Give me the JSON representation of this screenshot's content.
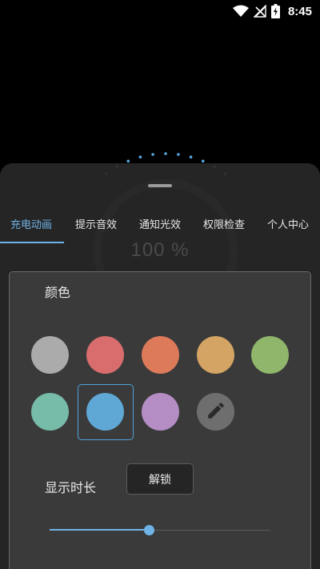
{
  "status_bar": {
    "time": "8:45",
    "icons": [
      "wifi-icon",
      "no-signal-icon",
      "battery-charging-icon"
    ]
  },
  "background": {
    "percent_text": "100 %"
  },
  "tabs": [
    {
      "label": "充电动画",
      "active": true
    },
    {
      "label": "提示音效",
      "active": false
    },
    {
      "label": "通知光效",
      "active": false
    },
    {
      "label": "权限检查",
      "active": false
    },
    {
      "label": "个人中心",
      "active": false
    }
  ],
  "panel": {
    "color_label": "颜色",
    "colors": [
      "#ababab",
      "#d96d6d",
      "#dc7a5a",
      "#d3a463",
      "#8fb66a",
      "#77bba9",
      "#5fa8d6",
      "#b58dc5"
    ],
    "selected_color_index": 6,
    "edit_icon": "pencil-icon",
    "duration_label": "显示时长",
    "unlock_button": "解锁",
    "duration_slider_value": 0.45,
    "accent_color": "#6fb3e6"
  }
}
